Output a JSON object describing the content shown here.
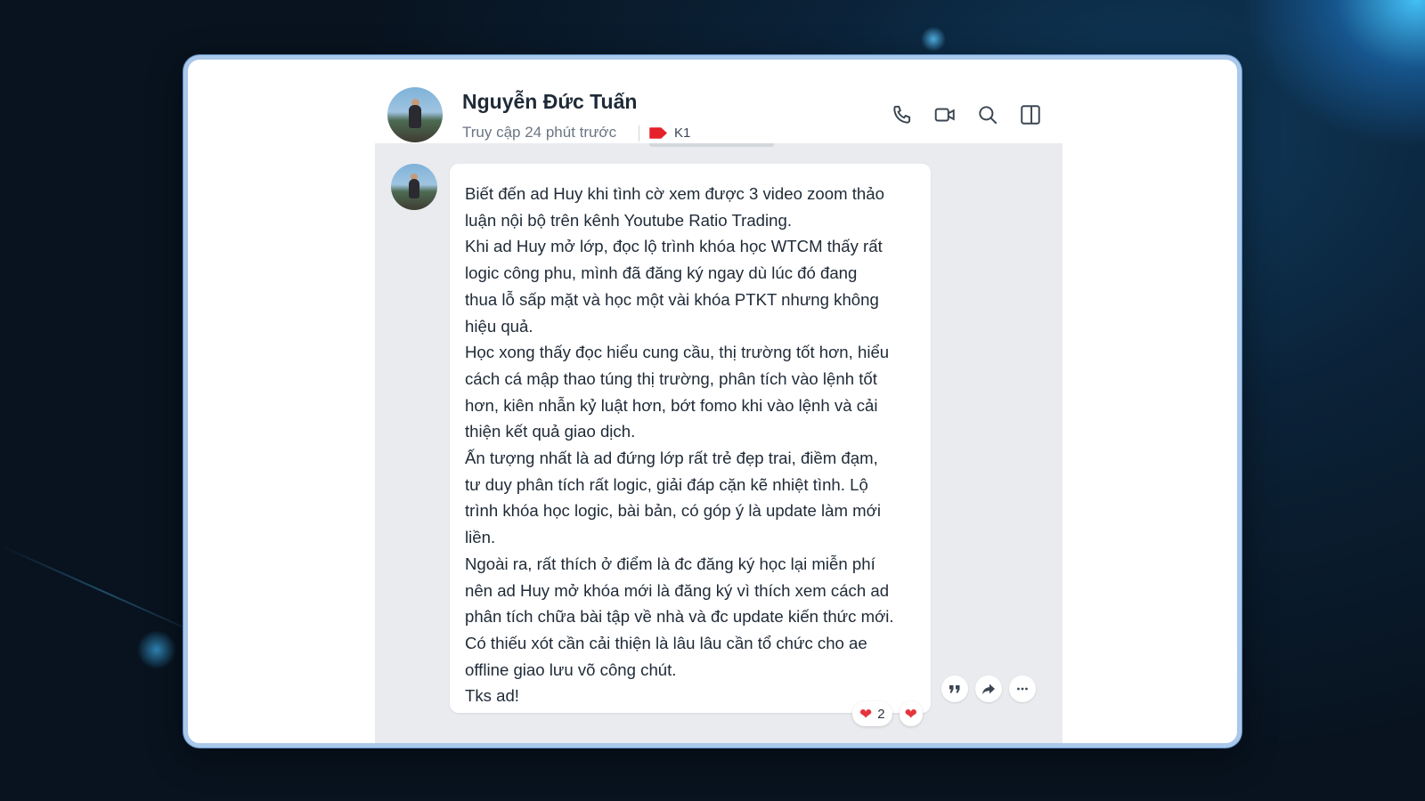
{
  "header": {
    "name": "Nguyễn Đức Tuấn",
    "status": "Truy cập 24 phút trước",
    "tag": {
      "label": "K1",
      "color": "#e5212b"
    },
    "actions": [
      {
        "icon": "phone-icon"
      },
      {
        "icon": "video-call-icon"
      },
      {
        "icon": "search-icon"
      },
      {
        "icon": "side-panel-icon"
      }
    ]
  },
  "message": {
    "lines": [
      "Biết đến ad Huy khi tình cờ xem được 3 video zoom thảo",
      "luận nội bộ trên kênh Youtube Ratio Trading.",
      "Khi ad Huy mở lớp, đọc lộ trình khóa học WTCM thấy rất",
      "logic công phu, mình đã đăng ký ngay dù lúc đó đang",
      "thua lỗ sấp mặt và học một vài khóa PTKT nhưng không",
      "hiệu quả.",
      "Học xong thấy đọc hiểu cung cầu, thị trường tốt hơn, hiểu",
      "cách cá mập thao túng thị trường, phân tích vào lệnh tốt",
      "hơn, kiên nhẫn kỷ luật hơn, bớt fomo khi vào lệnh và cải",
      "thiện kết quả giao dịch.",
      "Ấn tượng nhất là ad đứng lớp rất trẻ đẹp trai, điềm đạm,",
      "tư duy phân tích rất logic, giải đáp cặn kẽ nhiệt tình. Lộ",
      "trình khóa học logic, bài bản, có góp ý là update làm mới",
      "liền.",
      "Ngoài ra, rất thích ở điểm là đc đăng ký học lại miễn phí",
      "nên ad Huy mở khóa mới là đăng ký vì thích xem cách ad",
      "phân tích chữa bài tập về nhà và đc update kiến thức mới.",
      "Có thiếu xót cần cải thiện là lâu lâu cần tổ chức cho ae",
      "offline giao lưu võ công chút.",
      "Tks ad!"
    ],
    "reactions": [
      {
        "icon": "heart-icon",
        "count": "2"
      },
      {
        "icon": "heart-icon"
      }
    ],
    "actions": [
      {
        "icon": "quote-icon"
      },
      {
        "icon": "forward-icon"
      },
      {
        "icon": "more-icon"
      }
    ]
  },
  "colors": {
    "accent": "#a9c8ea",
    "heart": "#e5353b",
    "chat_bg": "#e9ebef"
  }
}
